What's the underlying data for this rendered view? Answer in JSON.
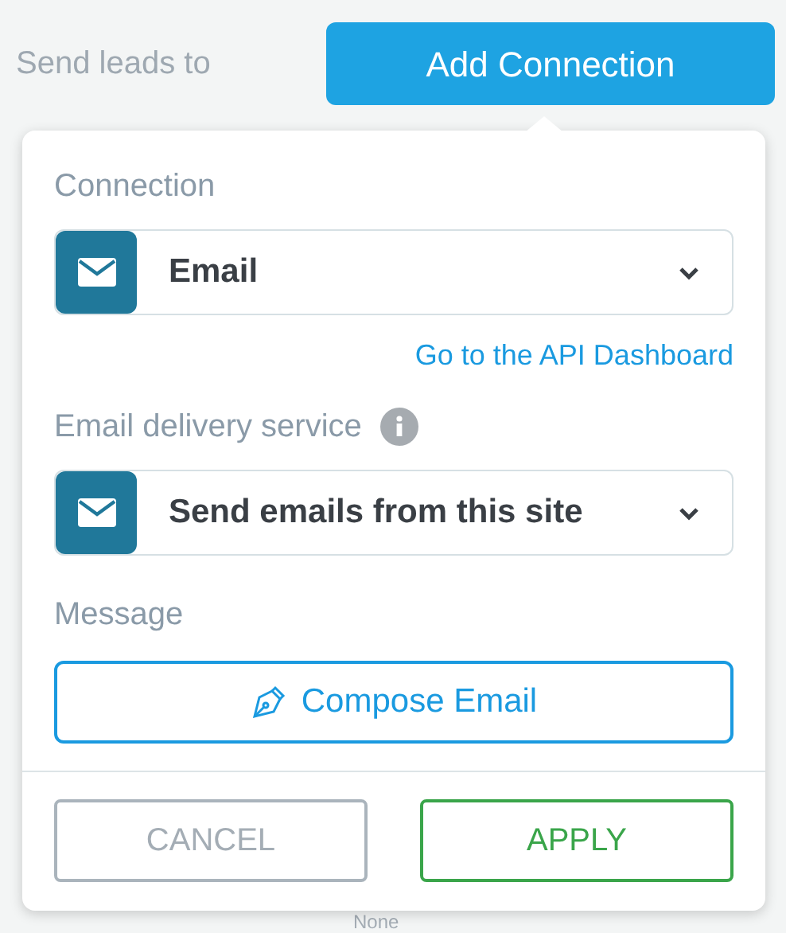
{
  "header": {
    "label": "Send leads to",
    "button": "Add Connection"
  },
  "popup": {
    "connection_label": "Connection",
    "connection": {
      "value": "Email"
    },
    "link": "Go to the API Dashboard",
    "service_label": "Email delivery service",
    "service": {
      "value": "Send emails from this site"
    },
    "message_label": "Message",
    "compose_button": "Compose Email",
    "buttons": [
      {
        "label": "CANCEL",
        "kind": "cancel"
      },
      {
        "label": "APPLY",
        "kind": "apply"
      }
    ]
  },
  "behind": {
    "text": "None"
  }
}
